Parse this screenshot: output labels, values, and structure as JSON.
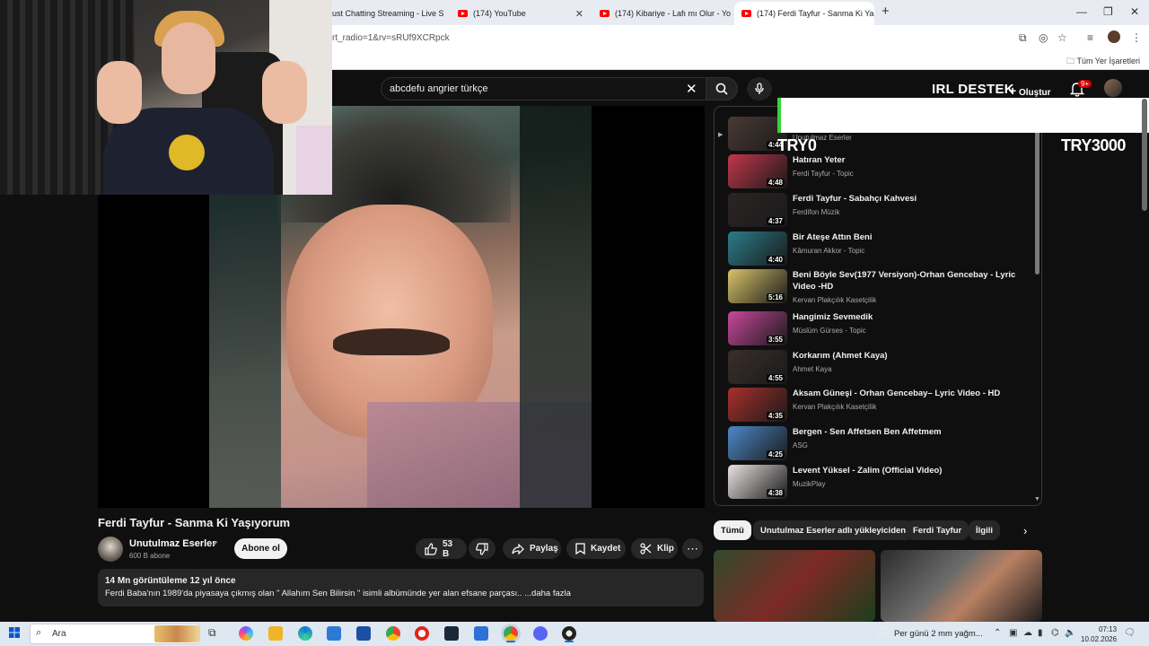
{
  "browser": {
    "tabs": [
      {
        "title": "ust Chatting Streaming - Live S",
        "active": false
      },
      {
        "title": "(174) YouTube",
        "active": false
      },
      {
        "title": "(174) Kibariye - Lafı mı Olur - Yo",
        "active": false
      },
      {
        "title": "(174) Ferdi Tayfur - Sanma Ki Ya",
        "active": true
      }
    ],
    "new_tab": "+",
    "address": "rt_radio=1&rv=sRUf9XCRpck",
    "bookmarks_all": "Tüm Yer İşaretleri",
    "window_controls": [
      "—",
      "❐",
      "✕"
    ]
  },
  "youtube": {
    "search_value": "abcdefu angrier türkçe",
    "channel_overlay_text": "IRL DESTEK",
    "create_label": "Oluştur",
    "notif_badge": "9+",
    "video": {
      "title": "Ferdi Tayfur - Sanma Ki Yaşıyorum",
      "channel": "Unutulmaz Eserler",
      "verified": "✔",
      "subscribers": "600 B abone",
      "subscribe_label": "Abone ol",
      "likes": "53 B",
      "share_label": "Paylaş",
      "save_label": "Kaydet",
      "clip_label": "Klip",
      "more_label": "⋯",
      "stats": "14 Mn görüntüleme  12 yıl önce",
      "description": "Ferdi Baba'nın 1989'da piyasaya çıkmış olan \" Allahım Sen Bilirsin \" isimli albümünde yer alan efsane parçası.. ...daha fazla"
    },
    "playlist": [
      {
        "title": "",
        "channel": "Unutulmaz Eserler",
        "duration": "4:44",
        "thumb": "#4a3a34"
      },
      {
        "title": "Hatıran Yeter",
        "channel": "Ferdi Tayfur - Topic",
        "duration": "4:48",
        "thumb": "#c2374b"
      },
      {
        "title": "Ferdi Tayfur - Sabahçı Kahvesi",
        "channel": "Ferdifon Müzik",
        "duration": "4:37",
        "thumb": "#2a2524"
      },
      {
        "title": "Bir Ateşe Attın Beni",
        "channel": "Kâmuran Akkor - Topic",
        "duration": "4:40",
        "thumb": "#2c7c8a"
      },
      {
        "title": "Beni Böyle Sev(1977 Versiyon)-Orhan Gencebay - Lyric Video -HD",
        "channel": "Kervan Plakçılık Kasetçilik",
        "duration": "5:16",
        "thumb": "#d8c46a"
      },
      {
        "title": "Hangimiz Sevmedik",
        "channel": "Müslüm Gürses - Topic",
        "duration": "3:55",
        "thumb": "#c7489b"
      },
      {
        "title": "Korkarım (Ahmet Kaya)",
        "channel": "Ahmet Kaya",
        "duration": "4:55",
        "thumb": "#3a2e2a"
      },
      {
        "title": "Aksam Güneşi - Orhan Gencebay– Lyric Video - HD",
        "channel": "Kervan Plakçılık Kasetçilik",
        "duration": "4:35",
        "thumb": "#a8302a"
      },
      {
        "title": "Bergen - Sen Affetsen Ben Affetmem",
        "channel": "ASG",
        "duration": "4:25",
        "thumb": "#4d88c9"
      },
      {
        "title": "Levent Yüksel - Zalim (Official Video)",
        "channel": "MuzikPlay",
        "duration": "4:38",
        "thumb": "#e9e4e2"
      }
    ],
    "chips": [
      "Tümü",
      "Unutulmaz Eserler adlı yükleyiciden",
      "Ferdi Tayfur",
      "İlgili"
    ],
    "overlay_try0": "TRY0",
    "overlay_try3000": "TRY3000"
  },
  "taskbar": {
    "search_placeholder": "Ara",
    "weather": "Per günü 2 mm yağm...",
    "time": "07:13",
    "date": "10.02.2026"
  }
}
